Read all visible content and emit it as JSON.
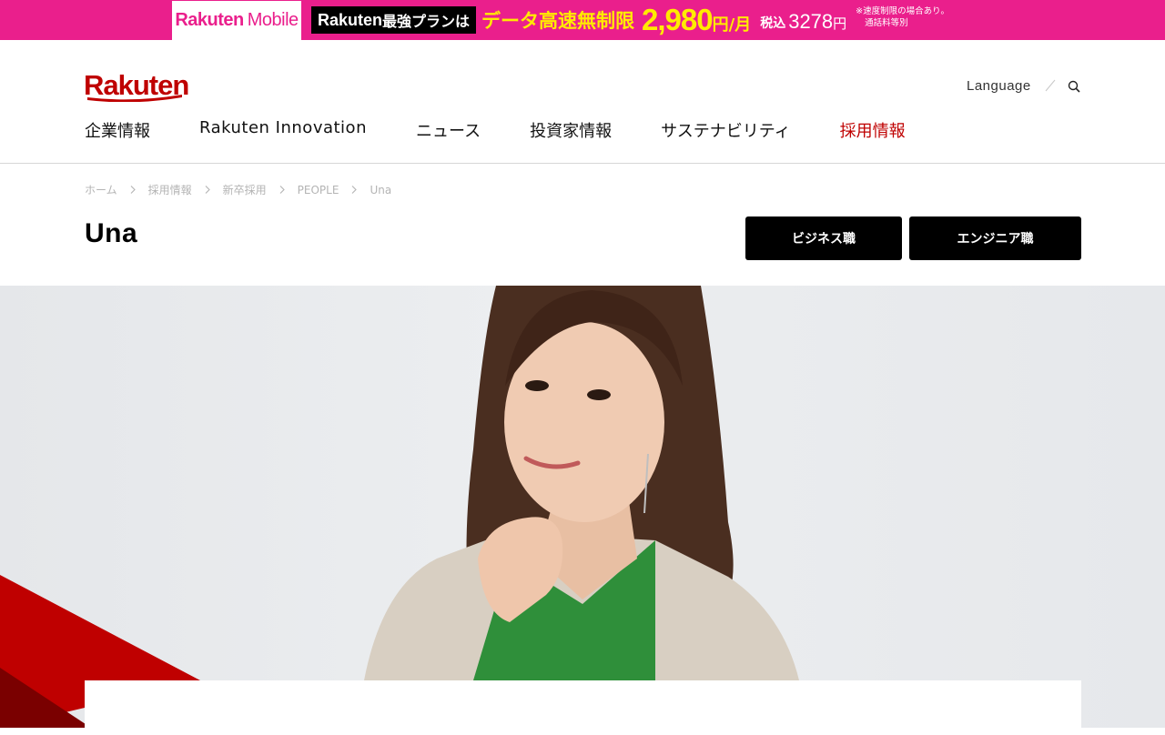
{
  "promo": {
    "logo_bold": "Rakuten",
    "logo_light": "Mobile",
    "plan_brand": "Rakuten",
    "plan_text": "最強プランは",
    "speed_text": "データ高速無制限",
    "price": "2,980",
    "price_unit": "円/月",
    "tax_label": "税込",
    "tax_price": "3278",
    "tax_unit": "円",
    "note_line1": "※速度制限の場合あり。",
    "note_line2": "通話料等別"
  },
  "header": {
    "logo": "Rakuten",
    "language": "Language",
    "nav": [
      {
        "label": "企業情報"
      },
      {
        "label": "Rakuten Innovation"
      },
      {
        "label": "ニュース"
      },
      {
        "label": "投資家情報"
      },
      {
        "label": "サステナビリティ"
      },
      {
        "label": "採用情報"
      }
    ]
  },
  "breadcrumb": [
    "ホーム",
    "採用情報",
    "新卒採用",
    "PEOPLE",
    "Una"
  ],
  "page": {
    "title": "Una",
    "buttons": {
      "business": "ビジネス職",
      "engineer": "エンジニア職"
    }
  },
  "colors": {
    "brand_red": "#bf0000",
    "promo_pink": "#ea1f8c",
    "promo_yellow": "#ffeb00",
    "button_black": "#000000"
  },
  "icons": {
    "search": "search-icon",
    "breadcrumb_separator": "chevron-right-icon"
  }
}
